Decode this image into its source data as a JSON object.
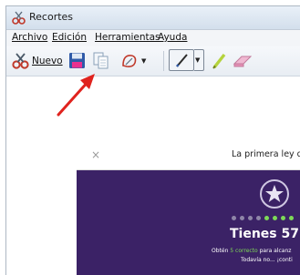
{
  "window": {
    "title": "Recortes"
  },
  "menu": {
    "items": [
      "Archivo",
      "Edición",
      "Herramientas",
      "Ayuda"
    ]
  },
  "toolbar": {
    "new_label": "Nuevo",
    "icons": [
      "scissors-icon",
      "save-icon",
      "copy-icon",
      "eraser-curve-icon",
      "pen-icon",
      "highlighter-icon",
      "eraser-icon"
    ]
  },
  "capture": {
    "close_symbol": "×",
    "title": "La primera ley de",
    "result": "Tienes 57",
    "line1_prefix": "Obtén ",
    "line1_highlight": "5 correcto",
    "line1_suffix": " para alcanz",
    "line2": "Todavía no... ¡conti",
    "colors": {
      "background": "#3b2266",
      "dot_done": "#7ed957",
      "dot_pending": "#8f86a8"
    }
  },
  "annotation": {
    "arrow_color": "#e0231e"
  }
}
